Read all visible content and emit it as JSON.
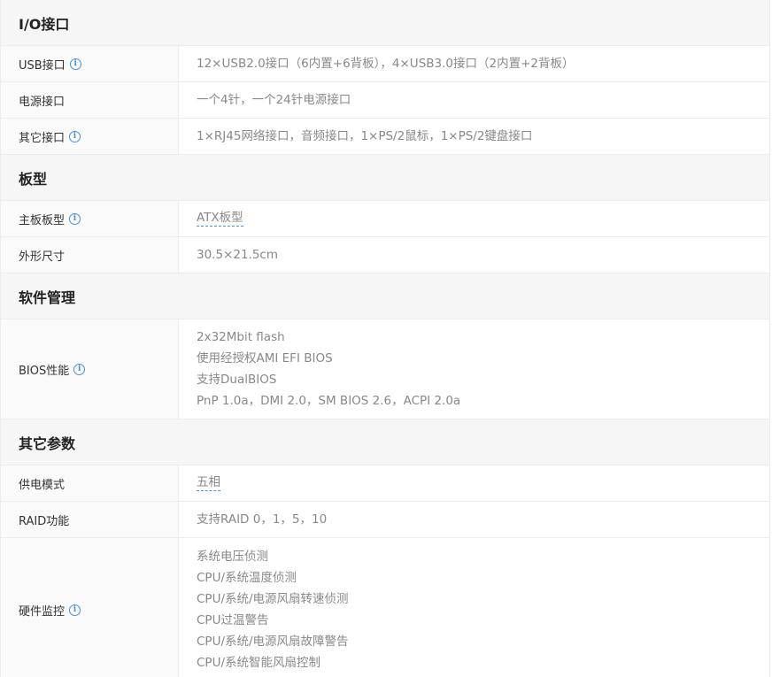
{
  "sections": [
    {
      "title": "I/O接口",
      "rows": [
        {
          "key": "USB接口",
          "info": true,
          "values": [
            "12×USB2.0接口（6内置+6背板），4×USB3.0接口（2内置+2背板）"
          ]
        },
        {
          "key": "电源接口",
          "info": false,
          "values": [
            "一个4针，一个24针电源接口"
          ]
        },
        {
          "key": "其它接口",
          "info": true,
          "values": [
            "1×RJ45网络接口，音频接口，1×PS/2鼠标，1×PS/2键盘接口"
          ]
        }
      ]
    },
    {
      "title": "板型",
      "rows": [
        {
          "key": "主板板型",
          "info": true,
          "values": [
            "ATX板型"
          ],
          "link": true
        },
        {
          "key": "外形尺寸",
          "info": false,
          "values": [
            "30.5×21.5cm"
          ]
        }
      ]
    },
    {
      "title": "软件管理",
      "rows": [
        {
          "key": "BIOS性能",
          "info": true,
          "values": [
            "2x32Mbit flash",
            "使用经授权AMI EFI BIOS",
            "支持DualBIOS",
            "PnP 1.0a，DMI 2.0，SM BIOS 2.6，ACPI 2.0a"
          ]
        }
      ]
    },
    {
      "title": "其它参数",
      "rows": [
        {
          "key": "供电模式",
          "info": false,
          "values": [
            "五相"
          ],
          "link": true
        },
        {
          "key": "RAID功能",
          "info": false,
          "values": [
            "支持RAID 0，1，5，10"
          ]
        },
        {
          "key": "硬件监控",
          "info": true,
          "values": [
            "系统电压侦测",
            "CPU/系统温度侦测",
            "CPU/系统/电源风扇转速侦测",
            "CPU过温警告",
            "CPU/系统/电源风扇故障警告",
            "CPU/系统智能风扇控制"
          ]
        }
      ]
    }
  ],
  "icons": {
    "info": "info-icon"
  },
  "info_glyph": "i",
  "colors": {
    "accent": "#4a90d9",
    "section_bg": "#f6f6f6",
    "key_bg": "#fafafa",
    "border": "#ececec"
  }
}
